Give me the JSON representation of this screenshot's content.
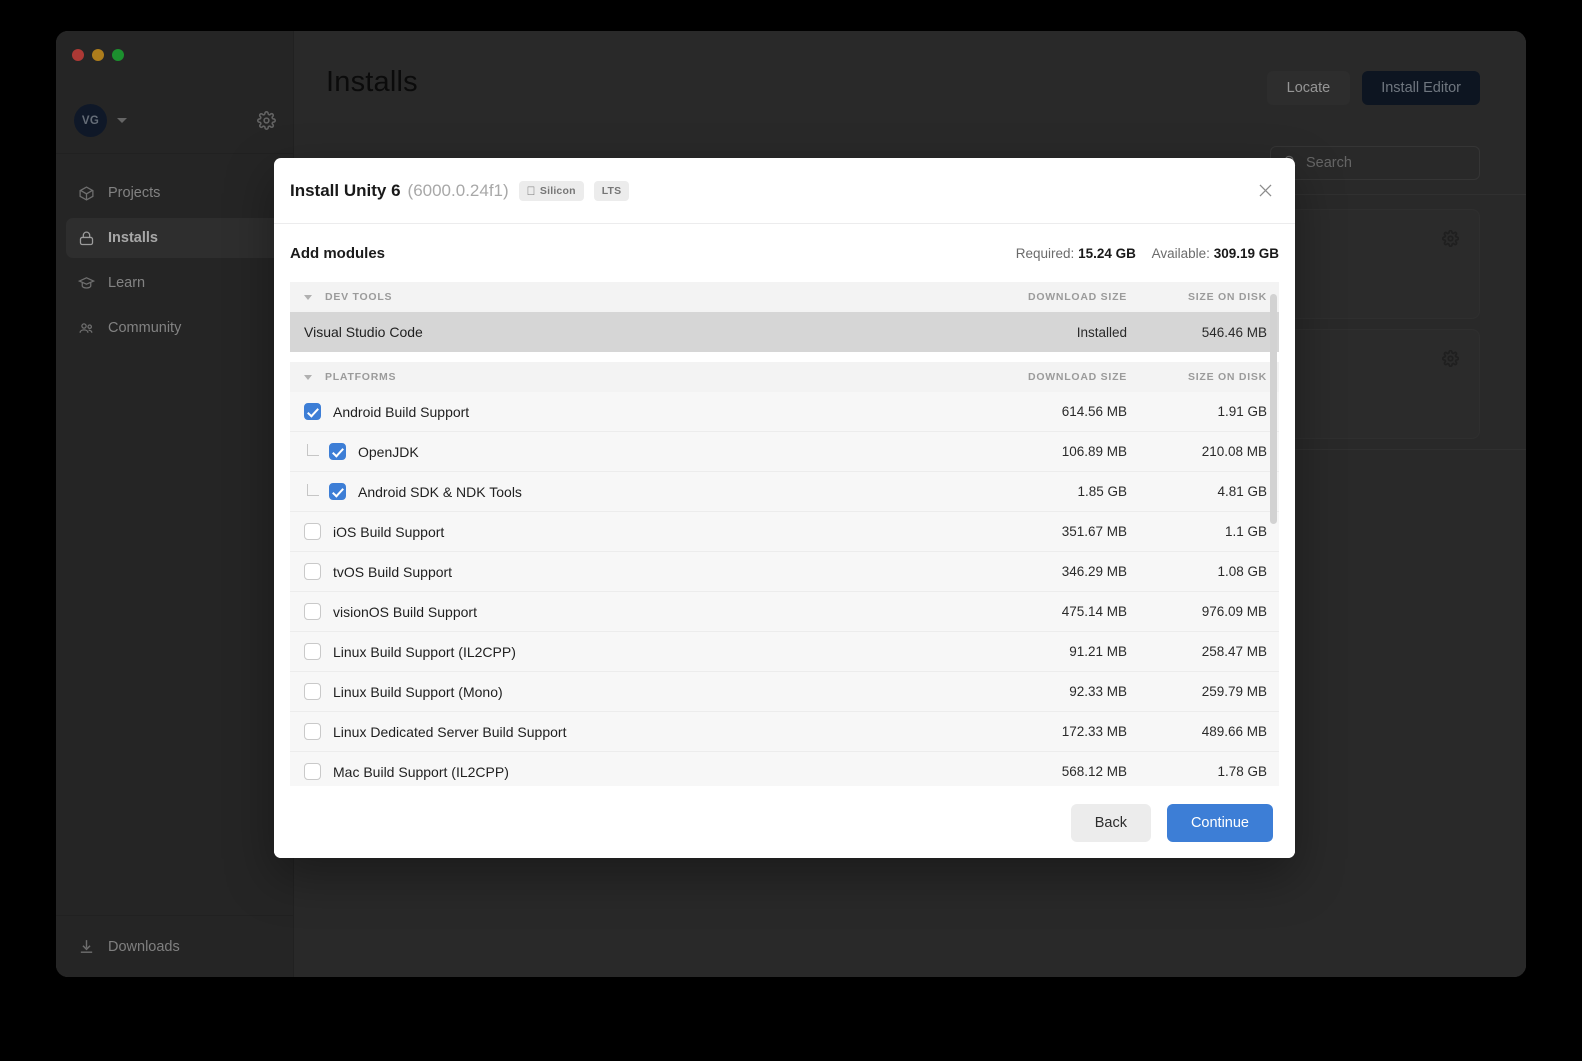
{
  "app": {
    "window_title": "Unity Hub",
    "traffic_lights": [
      "close",
      "minimize",
      "zoom"
    ],
    "account": {
      "initials": "VG"
    },
    "sidebar": {
      "items": [
        {
          "id": "projects",
          "label": "Projects",
          "icon": "cube-icon",
          "active": false
        },
        {
          "id": "installs",
          "label": "Installs",
          "icon": "lock-icon",
          "active": true
        },
        {
          "id": "learn",
          "label": "Learn",
          "icon": "graduation-icon",
          "active": false
        },
        {
          "id": "community",
          "label": "Community",
          "icon": "people-icon",
          "active": false
        }
      ],
      "downloads": {
        "label": "Downloads",
        "icon": "download-icon"
      }
    },
    "main": {
      "page_title": "Installs",
      "locate_label": "Locate",
      "install_editor_label": "Install Editor",
      "search_placeholder": "Search"
    }
  },
  "modal": {
    "title": "Install Unity 6",
    "version": "(6000.0.24f1)",
    "badges": [
      {
        "label": "Silicon",
        "icon": "apple-icon"
      },
      {
        "label": "LTS",
        "icon": ""
      }
    ],
    "close_icon": "close-icon",
    "subhead": {
      "title": "Add modules",
      "required_label": "Required:",
      "required_value": "15.24 GB",
      "available_label": "Available:",
      "available_value": "309.19 GB"
    },
    "columns": {
      "download_size": "DOWNLOAD SIZE",
      "size_on_disk": "SIZE ON DISK"
    },
    "groups": [
      {
        "id": "dev-tools",
        "label": "DEV TOOLS",
        "expanded": true,
        "rows": [
          {
            "label": "Visual Studio Code",
            "download_size": "Installed",
            "size_on_disk": "546.46 MB",
            "checkbox": "none",
            "indent": 0,
            "selected": true
          }
        ]
      },
      {
        "id": "platforms",
        "label": "PLATFORMS",
        "expanded": true,
        "rows": [
          {
            "label": "Android Build Support",
            "download_size": "614.56 MB",
            "size_on_disk": "1.91 GB",
            "checkbox": "checked",
            "indent": 0,
            "selected": false
          },
          {
            "label": "OpenJDK",
            "download_size": "106.89 MB",
            "size_on_disk": "210.08 MB",
            "checkbox": "checked",
            "indent": 1,
            "selected": false
          },
          {
            "label": "Android SDK & NDK Tools",
            "download_size": "1.85 GB",
            "size_on_disk": "4.81 GB",
            "checkbox": "checked",
            "indent": 1,
            "selected": false
          },
          {
            "label": "iOS Build Support",
            "download_size": "351.67 MB",
            "size_on_disk": "1.1 GB",
            "checkbox": "unchecked",
            "indent": 0,
            "selected": false
          },
          {
            "label": "tvOS Build Support",
            "download_size": "346.29 MB",
            "size_on_disk": "1.08 GB",
            "checkbox": "unchecked",
            "indent": 0,
            "selected": false
          },
          {
            "label": "visionOS Build Support",
            "download_size": "475.14 MB",
            "size_on_disk": "976.09 MB",
            "checkbox": "unchecked",
            "indent": 0,
            "selected": false
          },
          {
            "label": "Linux Build Support (IL2CPP)",
            "download_size": "91.21 MB",
            "size_on_disk": "258.47 MB",
            "checkbox": "unchecked",
            "indent": 0,
            "selected": false
          },
          {
            "label": "Linux Build Support (Mono)",
            "download_size": "92.33 MB",
            "size_on_disk": "259.79 MB",
            "checkbox": "unchecked",
            "indent": 0,
            "selected": false
          },
          {
            "label": "Linux Dedicated Server Build Support",
            "download_size": "172.33 MB",
            "size_on_disk": "489.66 MB",
            "checkbox": "unchecked",
            "indent": 0,
            "selected": false
          },
          {
            "label": "Mac Build Support (IL2CPP)",
            "download_size": "568.12 MB",
            "size_on_disk": "1.78 GB",
            "checkbox": "unchecked",
            "indent": 0,
            "selected": false
          }
        ]
      }
    ],
    "footer": {
      "back_label": "Back",
      "continue_label": "Continue"
    }
  },
  "colors": {
    "accent_blue": "#3d7ed6",
    "window_dark": "#3a3a3a",
    "sidebar_dark": "#343434",
    "row_bg": "#f7f7f7",
    "row_selected": "#d6d6d6",
    "group_header_bg": "#f3f3f3",
    "install_editor_bg": "#121e2e"
  }
}
